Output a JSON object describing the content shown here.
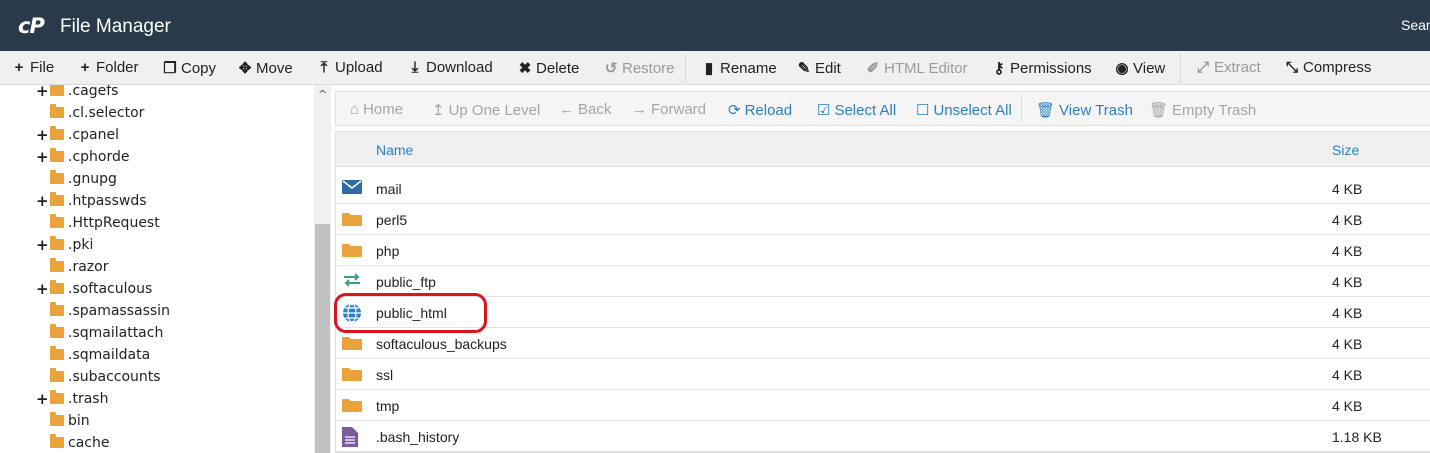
{
  "header": {
    "logo": "cP",
    "title": "File Manager",
    "search_label": "Search"
  },
  "toolbar": {
    "file": "File",
    "folder": "Folder",
    "copy": "Copy",
    "move": "Move",
    "upload": "Upload",
    "download": "Download",
    "delete": "Delete",
    "restore": "Restore",
    "rename": "Rename",
    "edit": "Edit",
    "html_editor": "HTML Editor",
    "permissions": "Permissions",
    "view": "View",
    "extract": "Extract",
    "compress": "Compress"
  },
  "tree": {
    "items": [
      {
        "label": ".cagefs",
        "expandable": true
      },
      {
        "label": ".cl.selector",
        "expandable": false
      },
      {
        "label": ".cpanel",
        "expandable": true
      },
      {
        "label": ".cphorde",
        "expandable": true
      },
      {
        "label": ".gnupg",
        "expandable": false
      },
      {
        "label": ".htpasswds",
        "expandable": true
      },
      {
        "label": ".HttpRequest",
        "expandable": false
      },
      {
        "label": ".pki",
        "expandable": true
      },
      {
        "label": ".razor",
        "expandable": false
      },
      {
        "label": ".softaculous",
        "expandable": true
      },
      {
        "label": ".spamassassin",
        "expandable": false
      },
      {
        "label": ".sqmailattach",
        "expandable": false
      },
      {
        "label": ".sqmaildata",
        "expandable": false
      },
      {
        "label": ".subaccounts",
        "expandable": false
      },
      {
        "label": ".trash",
        "expandable": true
      },
      {
        "label": "bin",
        "expandable": false
      },
      {
        "label": "cache",
        "expandable": false
      }
    ]
  },
  "navbar": {
    "home": "Home",
    "up_one_level": "Up One Level",
    "back": "Back",
    "forward": "Forward",
    "reload": "Reload",
    "select_all": "Select All",
    "unselect_all": "Unselect All",
    "view_trash": "View Trash",
    "empty_trash": "Empty Trash"
  },
  "table": {
    "col_name": "Name",
    "col_size": "Size",
    "rows": [
      {
        "name": "mail",
        "size": "4 KB",
        "icon": "mail-icon"
      },
      {
        "name": "perl5",
        "size": "4 KB",
        "icon": "folder-icon"
      },
      {
        "name": "php",
        "size": "4 KB",
        "icon": "folder-icon"
      },
      {
        "name": "public_ftp",
        "size": "4 KB",
        "icon": "transfer-icon"
      },
      {
        "name": "public_html",
        "size": "4 KB",
        "icon": "globe-icon"
      },
      {
        "name": "softaculous_backups",
        "size": "4 KB",
        "icon": "folder-icon"
      },
      {
        "name": "ssl",
        "size": "4 KB",
        "icon": "folder-icon"
      },
      {
        "name": "tmp",
        "size": "4 KB",
        "icon": "folder-icon"
      },
      {
        "name": ".bash_history",
        "size": "1.18 KB",
        "icon": "file-icon"
      }
    ]
  },
  "colors": {
    "header_bg": "#293a4a",
    "accent": "#2d7fc1",
    "highlight": "#d9141c",
    "folder": "#e9a33a"
  }
}
